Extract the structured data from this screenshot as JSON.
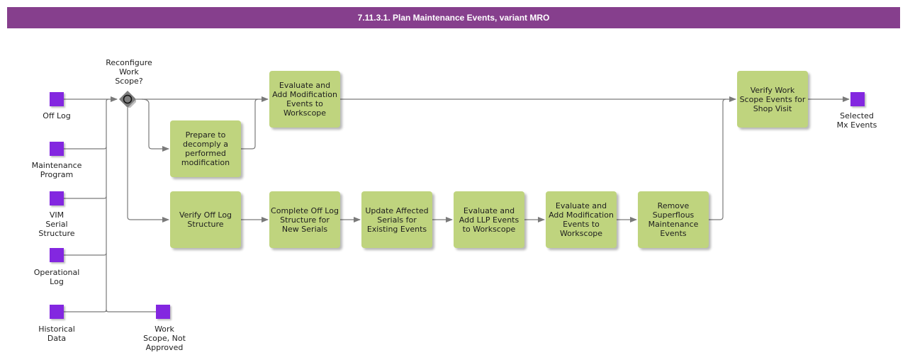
{
  "title": "7.11.3.1. Plan Maintenance Events, variant MRO",
  "colors": {
    "title_bar": "#863f8d",
    "task": "#bfd47e",
    "data_object": "#8327e0",
    "connector": "#7a7a7a"
  },
  "gateway": {
    "label": "Reconfigure\nWork\nScope?",
    "icon": "event-based-gateway-icon"
  },
  "inputs": [
    {
      "label": "Off Log"
    },
    {
      "label": "Maintenance\nProgram"
    },
    {
      "label": "VIM\nSerial\nStructure"
    },
    {
      "label": "Operational\nLog"
    },
    {
      "label": "Historical\nData"
    }
  ],
  "outputs": [
    {
      "label": "Work\nScope, Not\nApproved"
    },
    {
      "label": "Selected\nMx Events"
    }
  ],
  "tasks": {
    "eval_mod_top": "Evaluate and Add Modification Events to Workscope",
    "prepare_decomply": "Prepare to decomply a performed modification",
    "verify_off_log": "Verify Off Log Structure",
    "complete_off_log": "Complete Off Log Structure for New Serials",
    "update_serials": "Update Affected Serials for Existing Events",
    "eval_llp": "Evaluate and Add LLP Events to Workscope",
    "eval_mod_bottom": "Evaluate and Add Modification Events to Workscope",
    "remove_superflous": "Remove Superflous Maintenance Events",
    "verify_work_scope": "Verify Work Scope Events for Shop Visit"
  }
}
